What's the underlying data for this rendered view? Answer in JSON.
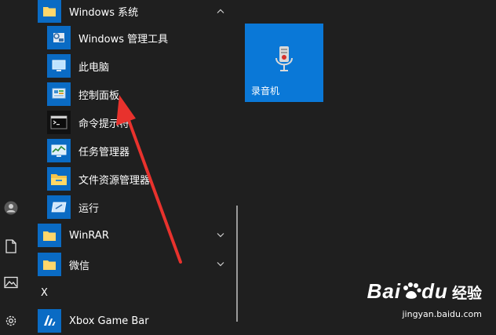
{
  "rail": {
    "items": [
      {
        "icon": "user-icon"
      },
      {
        "icon": "document-icon"
      },
      {
        "icon": "pictures-icon"
      },
      {
        "icon": "gear-icon"
      }
    ]
  },
  "applist": {
    "groups": {
      "windows_system": {
        "label": "Windows 系统",
        "expanded": true
      },
      "winrar": {
        "label": "WinRAR",
        "expanded": false
      },
      "wechat": {
        "label": "微信",
        "expanded": false
      }
    },
    "items": [
      {
        "label": "Windows 管理工具",
        "icon": "admin-tools-icon"
      },
      {
        "label": "此电脑",
        "icon": "this-pc-icon"
      },
      {
        "label": "控制面板",
        "icon": "control-panel-icon"
      },
      {
        "label": "命令提示符",
        "icon": "cmd-icon"
      },
      {
        "label": "任务管理器",
        "icon": "task-manager-icon"
      },
      {
        "label": "文件资源管理器",
        "icon": "file-explorer-icon"
      },
      {
        "label": "运行",
        "icon": "run-icon"
      }
    ],
    "letter_x": "X",
    "xbox": {
      "label": "Xbox Game Bar",
      "icon": "xbox-game-bar-icon"
    }
  },
  "tiles": [
    {
      "label": "录音机",
      "icon": "microphone-icon",
      "color": "#0a78d7"
    }
  ],
  "watermark": {
    "brand": "Bai",
    "brand2": "du",
    "jingyan": "经验",
    "url": "jingyan.baidu.com"
  },
  "colors": {
    "background": "#1f1f1f",
    "tile": "#0a78d7",
    "icon_bg": "#0a6bc4",
    "annotation_arrow": "#e8322d"
  }
}
